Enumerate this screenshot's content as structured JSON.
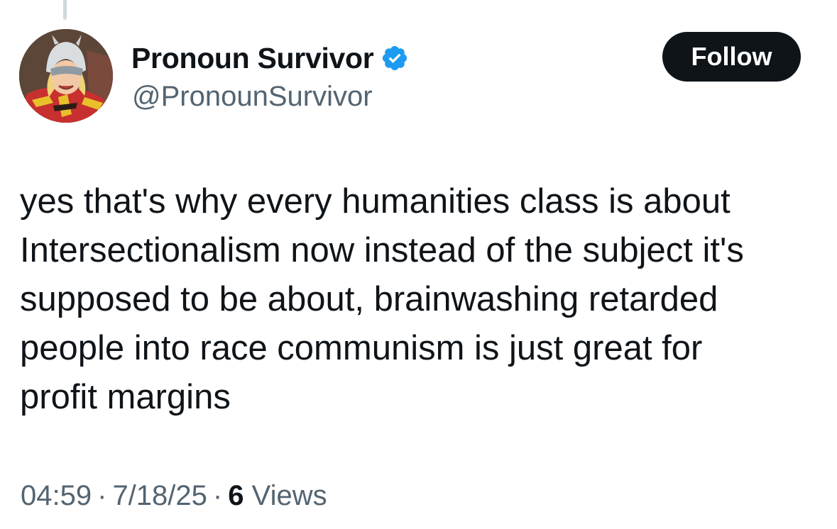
{
  "author": {
    "display_name": "Pronoun Survivor",
    "handle": "@PronounSurvivor",
    "verified": true,
    "verified_color": "#1d9bf0"
  },
  "follow_button": {
    "label": "Follow"
  },
  "tweet": {
    "text_lines": [
      "yes that's why every humanities class is about",
      "Intersectionalism now instead of the subject it's",
      "supposed to be about, brainwashing retarded",
      "people into race communism is just great for",
      "profit margins"
    ]
  },
  "meta": {
    "time": "04:59",
    "separator": "·",
    "date": "7/18/25",
    "views_count": "6",
    "views_label": "Views"
  },
  "icons": {
    "verified": "verified-badge-icon",
    "avatar": "avatar"
  }
}
